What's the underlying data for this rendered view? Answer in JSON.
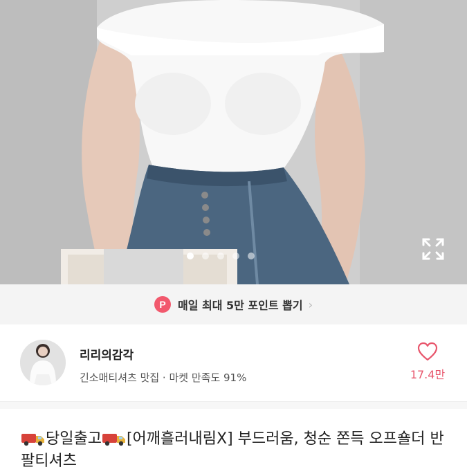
{
  "banner": {
    "badge": "P",
    "text": "매일 최대 5만 포인트 뽑기",
    "chevron": "›"
  },
  "gallery": {
    "total_images": 5,
    "active_index": 0,
    "expand_icon": "expand-icon"
  },
  "seller": {
    "name": "리리의감각",
    "subtitle": "긴소매티셔츠 맛집 · 마켓 만족도 91%",
    "likes": "17.4만",
    "like_icon": "heart-outline-icon"
  },
  "product": {
    "title_line1": "당일출고",
    "title_line2": "[어깨흘러내림X] 부드러움, 청순 쫀득 오프숄더 반팔티셔츠"
  },
  "colors": {
    "accent": "#e8566c",
    "badge": "#f2596d"
  }
}
